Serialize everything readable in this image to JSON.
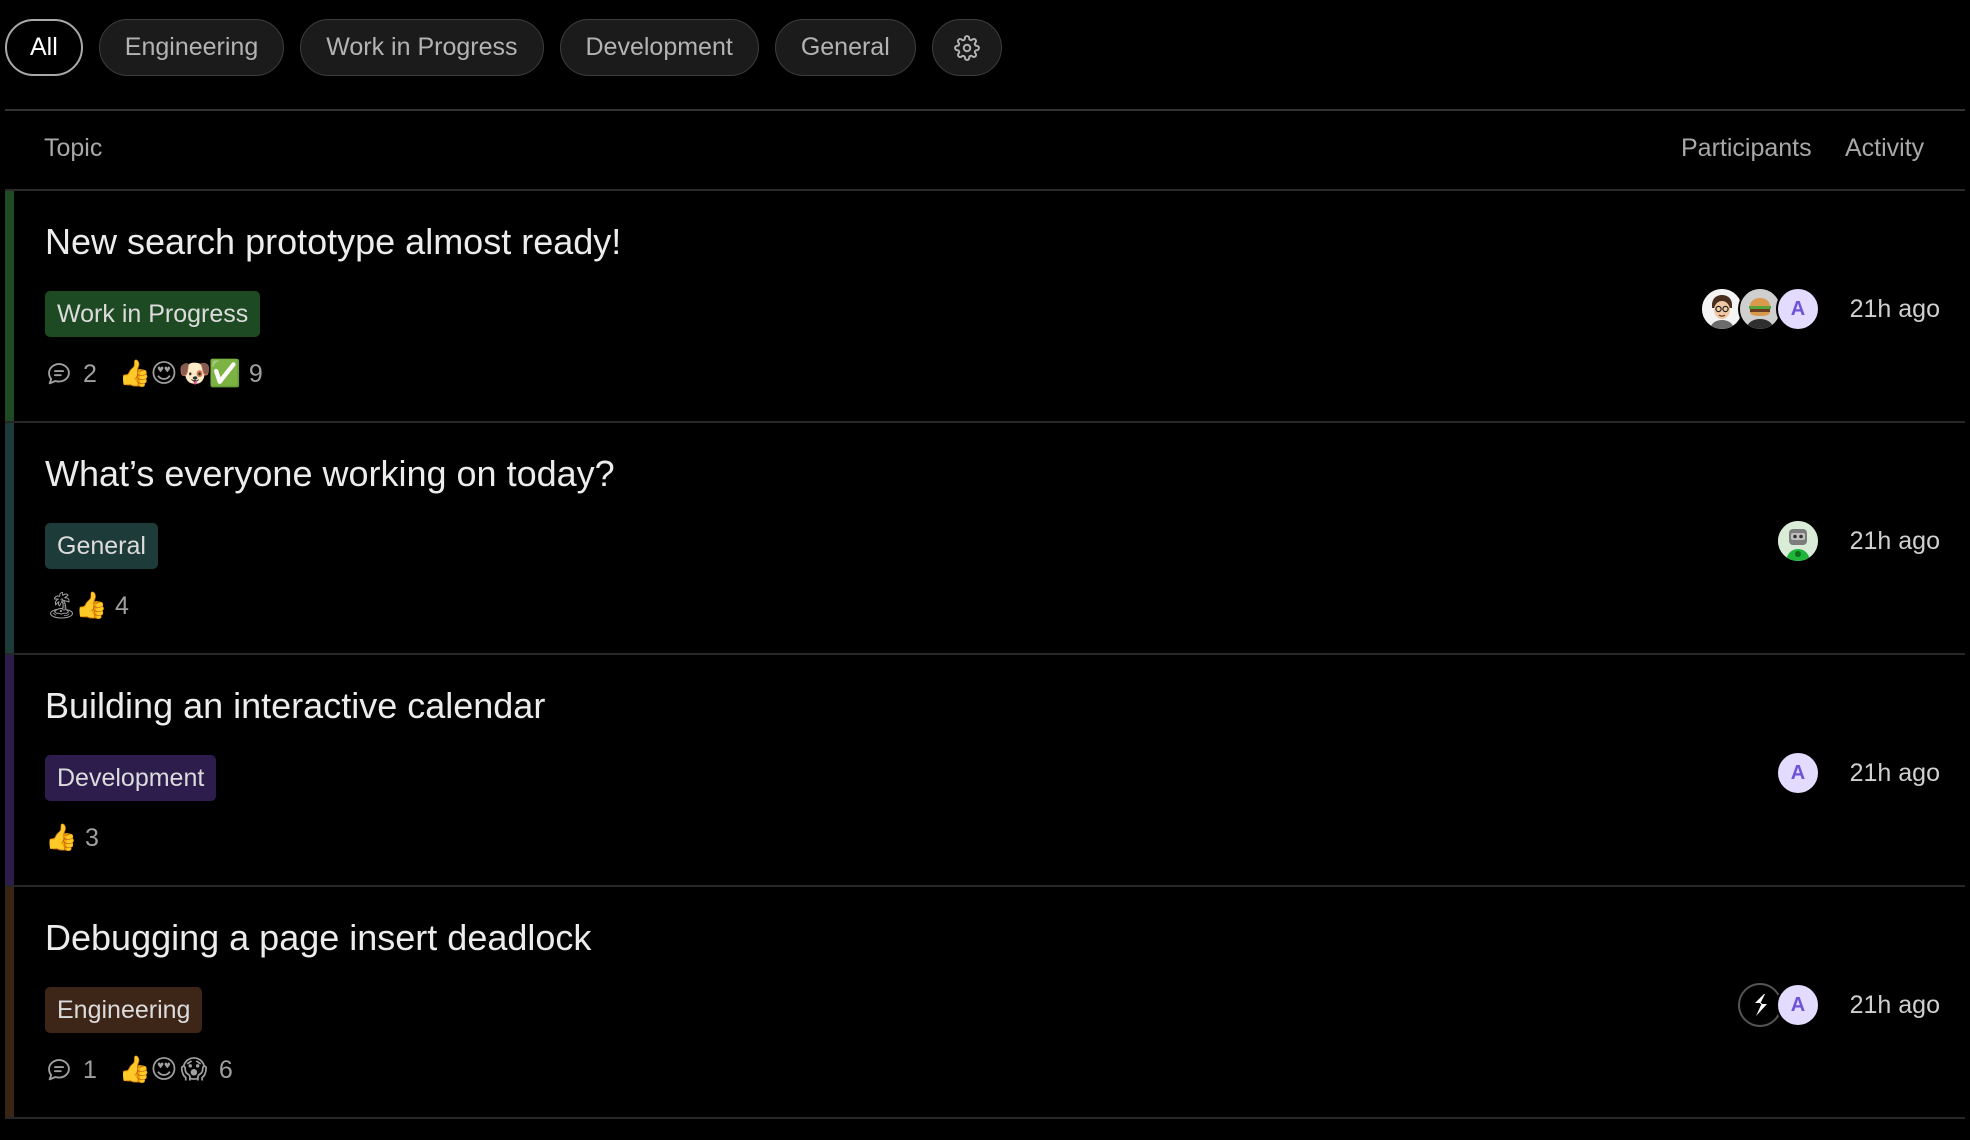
{
  "filters": [
    {
      "label": "All",
      "active": true
    },
    {
      "label": "Engineering",
      "active": false
    },
    {
      "label": "Work in Progress",
      "active": false
    },
    {
      "label": "Development",
      "active": false
    },
    {
      "label": "General",
      "active": false
    }
  ],
  "settings_icon": "gear-icon",
  "columns": {
    "topic": "Topic",
    "participants": "Participants",
    "activity": "Activity"
  },
  "topics": [
    {
      "title": "New search prototype almost ready!",
      "tag": "Work in Progress",
      "tag_color": "#1e4a23",
      "accent_color": "#1f4a24",
      "comments": "2",
      "reactions": [
        "👍",
        "😍",
        "🐶",
        "✅"
      ],
      "reaction_count": "9",
      "participants": [
        {
          "type": "image",
          "icon": "person-glasses-avatar"
        },
        {
          "type": "image",
          "icon": "burger-avatar"
        },
        {
          "type": "letter",
          "letter": "A"
        }
      ],
      "activity": "21h ago"
    },
    {
      "title": "What’s everyone working on today?",
      "tag": "General",
      "tag_color": "#1d3b38",
      "accent_color": "#1d3b38",
      "comments": "",
      "reactions": [
        "🏝",
        "👍"
      ],
      "reaction_count": "4",
      "participants": [
        {
          "type": "image",
          "icon": "robot-avatar"
        }
      ],
      "activity": "21h ago"
    },
    {
      "title": "Building an interactive calendar",
      "tag": "Development",
      "tag_color": "#2c1d4d",
      "accent_color": "#2c1d4d",
      "comments": "",
      "reactions": [
        "👍"
      ],
      "reaction_count": "3",
      "participants": [
        {
          "type": "letter",
          "letter": "A"
        }
      ],
      "activity": "21h ago"
    },
    {
      "title": "Debugging a page insert deadlock",
      "tag": "Engineering",
      "tag_color": "#3d2517",
      "accent_color": "#3a2414",
      "comments": "1",
      "reactions": [
        "👍",
        "😍",
        "😱"
      ],
      "reaction_count": "6",
      "participants": [
        {
          "type": "image",
          "icon": "logo-s-avatar"
        },
        {
          "type": "letter",
          "letter": "A"
        }
      ],
      "activity": "21h ago"
    }
  ]
}
